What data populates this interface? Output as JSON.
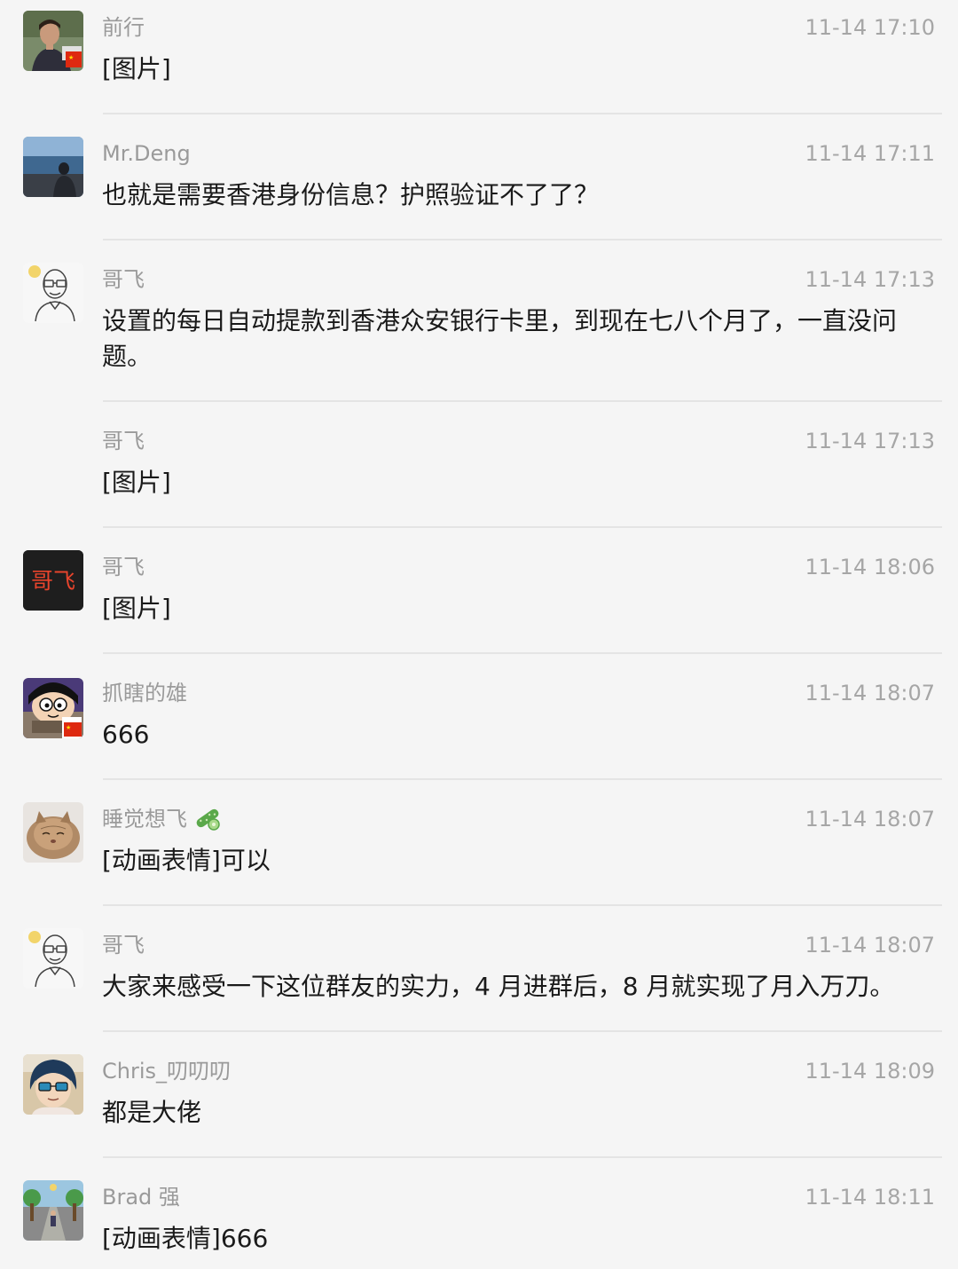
{
  "messages": [
    {
      "sender": "前行",
      "time": "11-14 17:10",
      "content": "[图片]",
      "avatar": "photo-man-avatar"
    },
    {
      "sender": "Mr.Deng",
      "time": "11-14 17:11",
      "content": "也就是需要香港身份信息？护照验证不了了？",
      "avatar": "lake-photo-avatar"
    },
    {
      "sender": "哥飞",
      "time": "11-14 17:13",
      "content": "设置的每日自动提款到香港众安银行卡里，到现在七八个月了，一直没问题。",
      "avatar": "sketch-man-avatar"
    },
    {
      "sender": "哥飞",
      "time": "11-14 17:13",
      "content": "[图片]",
      "avatar": ""
    },
    {
      "sender": "哥飞",
      "time": "11-14 18:06",
      "content": "[图片]",
      "avatar": "gefei-logo-avatar",
      "avatar_text": "哥飞"
    },
    {
      "sender": "抓瞎的雄",
      "time": "11-14 18:07",
      "content": "666",
      "avatar": "cartoon-boy-avatar"
    },
    {
      "sender": "睡觉想飞",
      "time": "11-14 18:07",
      "content": "[动画表情]可以",
      "avatar": "cat-avatar",
      "name_icon": "cucumber-icon"
    },
    {
      "sender": "哥飞",
      "time": "11-14 18:07",
      "content": "大家来感受一下这位群友的实力，4 月进群后，8 月就实现了月入万刀。",
      "avatar": "sketch-man-avatar"
    },
    {
      "sender": "Chris_叨叨叨",
      "time": "11-14 18:09",
      "content": "都是大佬",
      "avatar": "anime-avatar"
    },
    {
      "sender": "Brad 强",
      "time": "11-14 18:11",
      "content": "[动画表情]666",
      "avatar": "street-painting-avatar"
    }
  ],
  "colors": {
    "background": "#f5f5f5",
    "name_text": "#9a9a9a",
    "time_text": "#a6a6a6",
    "message_text": "#1a1a1a",
    "divider": "#e4e4e4",
    "gefei_logo_bg": "#1e1e1e",
    "gefei_logo_text": "#e8442c"
  }
}
